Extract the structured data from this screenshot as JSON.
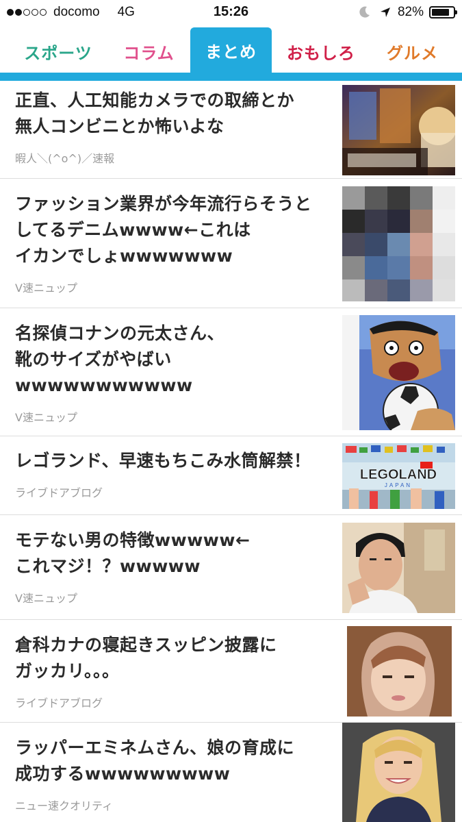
{
  "status_bar": {
    "carrier": "docomo",
    "network": "4G",
    "time": "15:26",
    "battery_percent": "82%",
    "battery_level": 0.82,
    "signal_bars_filled": 2,
    "signal_bars_total": 5
  },
  "tabs": [
    {
      "label": "スポーツ",
      "color": "#2aa68a",
      "active": false
    },
    {
      "label": "コラム",
      "color": "#e0508c",
      "active": false
    },
    {
      "label": "まとめ",
      "color": "#ffffff",
      "active": true
    },
    {
      "label": "おもしろ",
      "color": "#d02048",
      "active": false
    },
    {
      "label": "グルメ",
      "color": "#e07a2a",
      "active": false
    }
  ],
  "accent_color": "#22aadd",
  "articles": [
    {
      "title_lines": [
        "正直、人工知能カメラでの取締とか",
        "無人コンビニとか怖いよな"
      ],
      "source": "暇人＼(^o^)／速報",
      "thumb": "game-art-thumbnail"
    },
    {
      "title_lines": [
        "ファッション業界が今年流行らそうと",
        "してるデニムwwww←これは",
        "イカンでしょwwwwwww"
      ],
      "source": "V速ニュップ",
      "thumb": "pixelated-person-thumbnail"
    },
    {
      "title_lines": [
        "名探偵コナンの元太さん、",
        "靴のサイズがやばい",
        "wwwwwwwwwww"
      ],
      "source": "V速ニュップ",
      "thumb": "anime-character-thumbnail"
    },
    {
      "title_lines": [
        "レゴランド、早速もちこみ水筒解禁！"
      ],
      "source": "ライブドアブログ",
      "thumb": "legoland-thumbnail",
      "thumb_text": "LEGOLAND",
      "thumb_subtext": "JAPAN"
    },
    {
      "title_lines": [
        "モテない男の特徴wwwww←",
        "これマジ！？wwwww"
      ],
      "source": "V速ニュップ",
      "thumb": "man-photo-thumbnail"
    },
    {
      "title_lines": [
        "倉科カナの寝起きスッピン披露に",
        "ガッカリ。。。"
      ],
      "source": "ライブドアブログ",
      "thumb": "woman-photo-thumbnail"
    },
    {
      "title_lines": [
        "ラッパーエミネムさん、娘の育成に",
        "成功するwwwwwwwww"
      ],
      "source": "ニュー速クオリティ",
      "thumb": "girl-photo-thumbnail"
    }
  ]
}
